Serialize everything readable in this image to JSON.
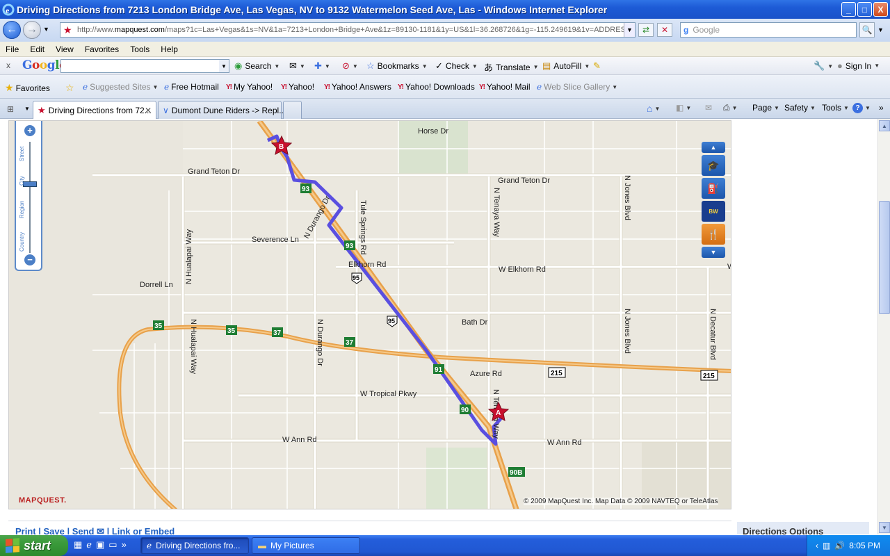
{
  "window": {
    "title": "Driving Directions from 7213 London Bridge Ave, Las Vegas, NV to 9132 Watermelon Seed Ave, Las  - Windows Internet Explorer",
    "minimize": "_",
    "maximize": "□",
    "close": "X"
  },
  "address_bar": {
    "url_prefix": "http://www.",
    "url_domain": "mapquest.com",
    "url_rest": "/maps?1c=Las+Vegas&1s=NV&1a=7213+London+Bridge+Ave&1z=89130-1181&1y=US&1l=36.268726&1g=-115.249619&1v=ADDRES",
    "search_placeholder": "Google"
  },
  "menu": [
    "File",
    "Edit",
    "View",
    "Favorites",
    "Tools",
    "Help"
  ],
  "google_toolbar": {
    "close": "x",
    "logo": "Google",
    "items": [
      {
        "icon": "search-icon",
        "label": "Search"
      },
      {
        "icon": "bookmark-star-icon",
        "label": "Bookmarks"
      },
      {
        "icon": "spell-check-icon",
        "label": "Check"
      },
      {
        "icon": "translate-icon",
        "label": "Translate"
      },
      {
        "icon": "autofill-icon",
        "label": "AutoFill"
      }
    ],
    "sign_in": "Sign In"
  },
  "favorites_bar": {
    "favorites_label": "Favorites",
    "links": [
      "Suggested Sites",
      "Free Hotmail",
      "My Yahoo!",
      "Yahoo!",
      "Yahoo! Answers",
      "Yahoo! Downloads",
      "Yahoo! Mail",
      "Web Slice Gallery"
    ]
  },
  "tabs": [
    {
      "label": "Driving Directions from 72...",
      "active": true
    },
    {
      "label": "Dumont Dune Riders -> Repl...",
      "active": false
    }
  ],
  "command_bar": [
    "Page",
    "Safety",
    "Tools"
  ],
  "map": {
    "streets": {
      "horse": "Horse Dr",
      "grand_teton_w": "Grand Teton Dr",
      "grand_teton_e": "Grand Teton Dr",
      "severence": "Severence Ln",
      "elkhorn": "Elkhorn Rd",
      "w_elkhorn": "W Elkhorn Rd",
      "dorrell": "Dorrell Ln",
      "bath": "Bath Dr",
      "azure": "Azure Rd",
      "tropical": "W Tropical Pkwy",
      "w_ann_w": "W Ann Rd",
      "w_ann_e": "W Ann Rd",
      "hualapai_n": "N Hualapai Way",
      "hualapai_s": "N Hualapai Way",
      "durango_diag": "N Durango Dr",
      "durango_s": "N Durango Dr",
      "tule": "Tule Springs Rd",
      "tenaya_n": "N Tenaya Way",
      "tenaya_s": "N Tenaya Way",
      "jones_n": "N Jones Blvd",
      "jones_s": "N Jones Blvd",
      "decatur": "N Decatur Blvd",
      "edge_w": "W"
    },
    "shields": {
      "exit93a": "93",
      "exit93b": "93",
      "exit91": "91",
      "exit90": "90",
      "exit90b": "90B",
      "exit35a": "35",
      "exit35b": "35",
      "exit37a": "37",
      "exit37b": "37",
      "us95a": "95",
      "us95b": "95",
      "sr215a": "215",
      "sr215b": "215"
    },
    "markers": {
      "start": "A",
      "end": "B"
    },
    "zoom_labels": [
      "Street",
      "City",
      "Region",
      "Country"
    ],
    "zoom_level": "City",
    "logo": "MAPQUEST.",
    "copyright": "© 2009 MapQuest Inc. Map Data  © 2009 NAVTEQ  or  TeleAtlas",
    "colors": {
      "route": "#5a4fe0",
      "highway": "#e8a14a",
      "background": "#e9e6dd"
    }
  },
  "page_footer": {
    "links": "Print  |  Save  |  Send  ✉  |  Link or Embed",
    "directions_options": "Directions Options"
  },
  "taskbar": {
    "start": "start",
    "windows": [
      {
        "label": "Driving Directions fro...",
        "active": true
      },
      {
        "label": "My Pictures",
        "active": false
      }
    ],
    "clock": "8:05 PM"
  }
}
